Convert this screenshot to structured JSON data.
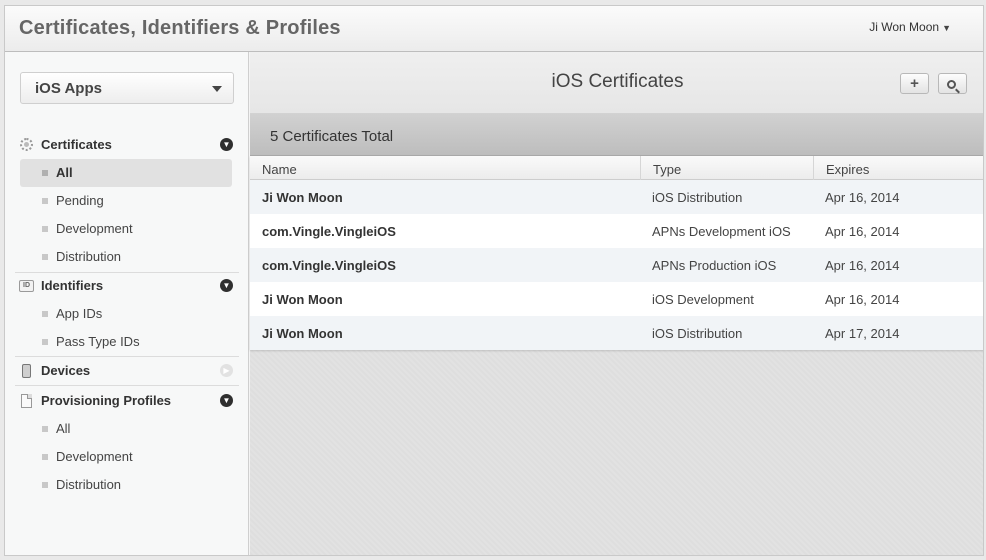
{
  "header": {
    "title": "Certificates, Identifiers & Profiles",
    "user": "Ji Won Moon"
  },
  "sidebar": {
    "platform": "iOS Apps",
    "sections": {
      "certificates": {
        "label": "Certificates",
        "items": [
          "All",
          "Pending",
          "Development",
          "Distribution"
        ],
        "active": "All"
      },
      "identifiers": {
        "label": "Identifiers",
        "icon_text": "ID",
        "items": [
          "App IDs",
          "Pass Type IDs"
        ]
      },
      "devices": {
        "label": "Devices"
      },
      "provisioning": {
        "label": "Provisioning Profiles",
        "items": [
          "All",
          "Development",
          "Distribution"
        ]
      }
    }
  },
  "main": {
    "title": "iOS Certificates",
    "add_symbol": "+",
    "count_label": "5 Certificates Total",
    "columns": [
      "Name",
      "Type",
      "Expires"
    ],
    "rows": [
      {
        "name": "Ji Won Moon",
        "type": "iOS Distribution",
        "expires": "Apr 16, 2014"
      },
      {
        "name": "com.Vingle.VingleiOS",
        "type": "APNs Development iOS",
        "expires": "Apr 16, 2014"
      },
      {
        "name": "com.Vingle.VingleiOS",
        "type": "APNs Production iOS",
        "expires": "Apr 16, 2014"
      },
      {
        "name": "Ji Won Moon",
        "type": "iOS Development",
        "expires": "Apr 16, 2014"
      },
      {
        "name": "Ji Won Moon",
        "type": "iOS Distribution",
        "expires": "Apr 17, 2014"
      }
    ]
  }
}
